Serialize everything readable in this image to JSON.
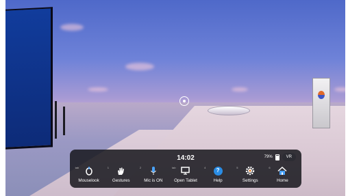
{
  "toolbar": {
    "time": "14:02",
    "battery": "79%",
    "vr_label": "VR",
    "buttons": [
      {
        "label": "Mouselook",
        "hint": "tab"
      },
      {
        "label": "Gestures",
        "hint": "1"
      },
      {
        "label": "Mic is ON",
        "hint": "2"
      },
      {
        "label": "Open Tablet",
        "hint": "tab"
      },
      {
        "label": "Help",
        "hint": "4"
      },
      {
        "label": "Settings",
        "hint": "5"
      },
      {
        "label": "Home",
        "hint": "6"
      }
    ]
  }
}
